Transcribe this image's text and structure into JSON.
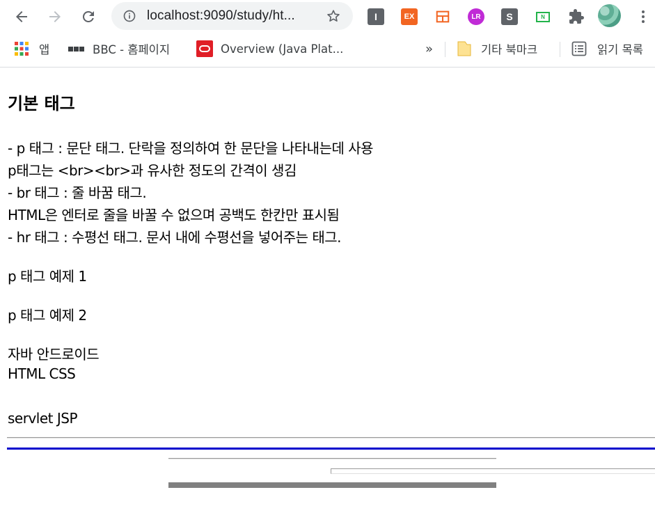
{
  "browser": {
    "url": "localhost:9090/study/ht...",
    "extensions": [
      {
        "name": "extension-i",
        "letter": "I",
        "color": "#5f6368"
      },
      {
        "name": "extension-ex",
        "letter": "EX",
        "color": "#f26522"
      },
      {
        "name": "extension-layout",
        "letter": "",
        "color": "#f26522"
      },
      {
        "name": "extension-lr",
        "letter": "LR",
        "color": "#c02bd6"
      },
      {
        "name": "extension-s",
        "letter": "S",
        "color": "#5f6368"
      },
      {
        "name": "extension-n",
        "letter": "N",
        "color": "#22b34a"
      }
    ]
  },
  "bookmarks": {
    "apps_label": "앱",
    "items": [
      {
        "label": "BBC - 홈페이지"
      },
      {
        "label": "Overview (Java Plat..."
      }
    ],
    "overflow": "»",
    "other_label": "기타 북마크",
    "reading_label": "읽기 목록"
  },
  "page": {
    "heading": "기본 태그",
    "lines": [
      "- p 태그 : 문단 태그. 단락을 정의하여 한 문단을 나타내는데 사용",
      "p태그는 <br><br>과 유사한 정도의 간격이 생김",
      "- br 태그 : 줄 바꿈 태그.",
      "HTML은 엔터로 줄을 바꿀 수 없으며 공백도 한칸만 표시됨",
      "- hr 태그 : 수평선 태그. 문서 내에 수평선을 넣어주는 태그."
    ],
    "example1": "p 태그 예제 1",
    "example2": "p 태그 예제 2",
    "text1": "자바 안드로이드",
    "text2": "HTML CSS",
    "text3": "servlet JSP"
  },
  "colors": {
    "blue_rule": "#0000cd",
    "gray_rule": "#808080"
  }
}
